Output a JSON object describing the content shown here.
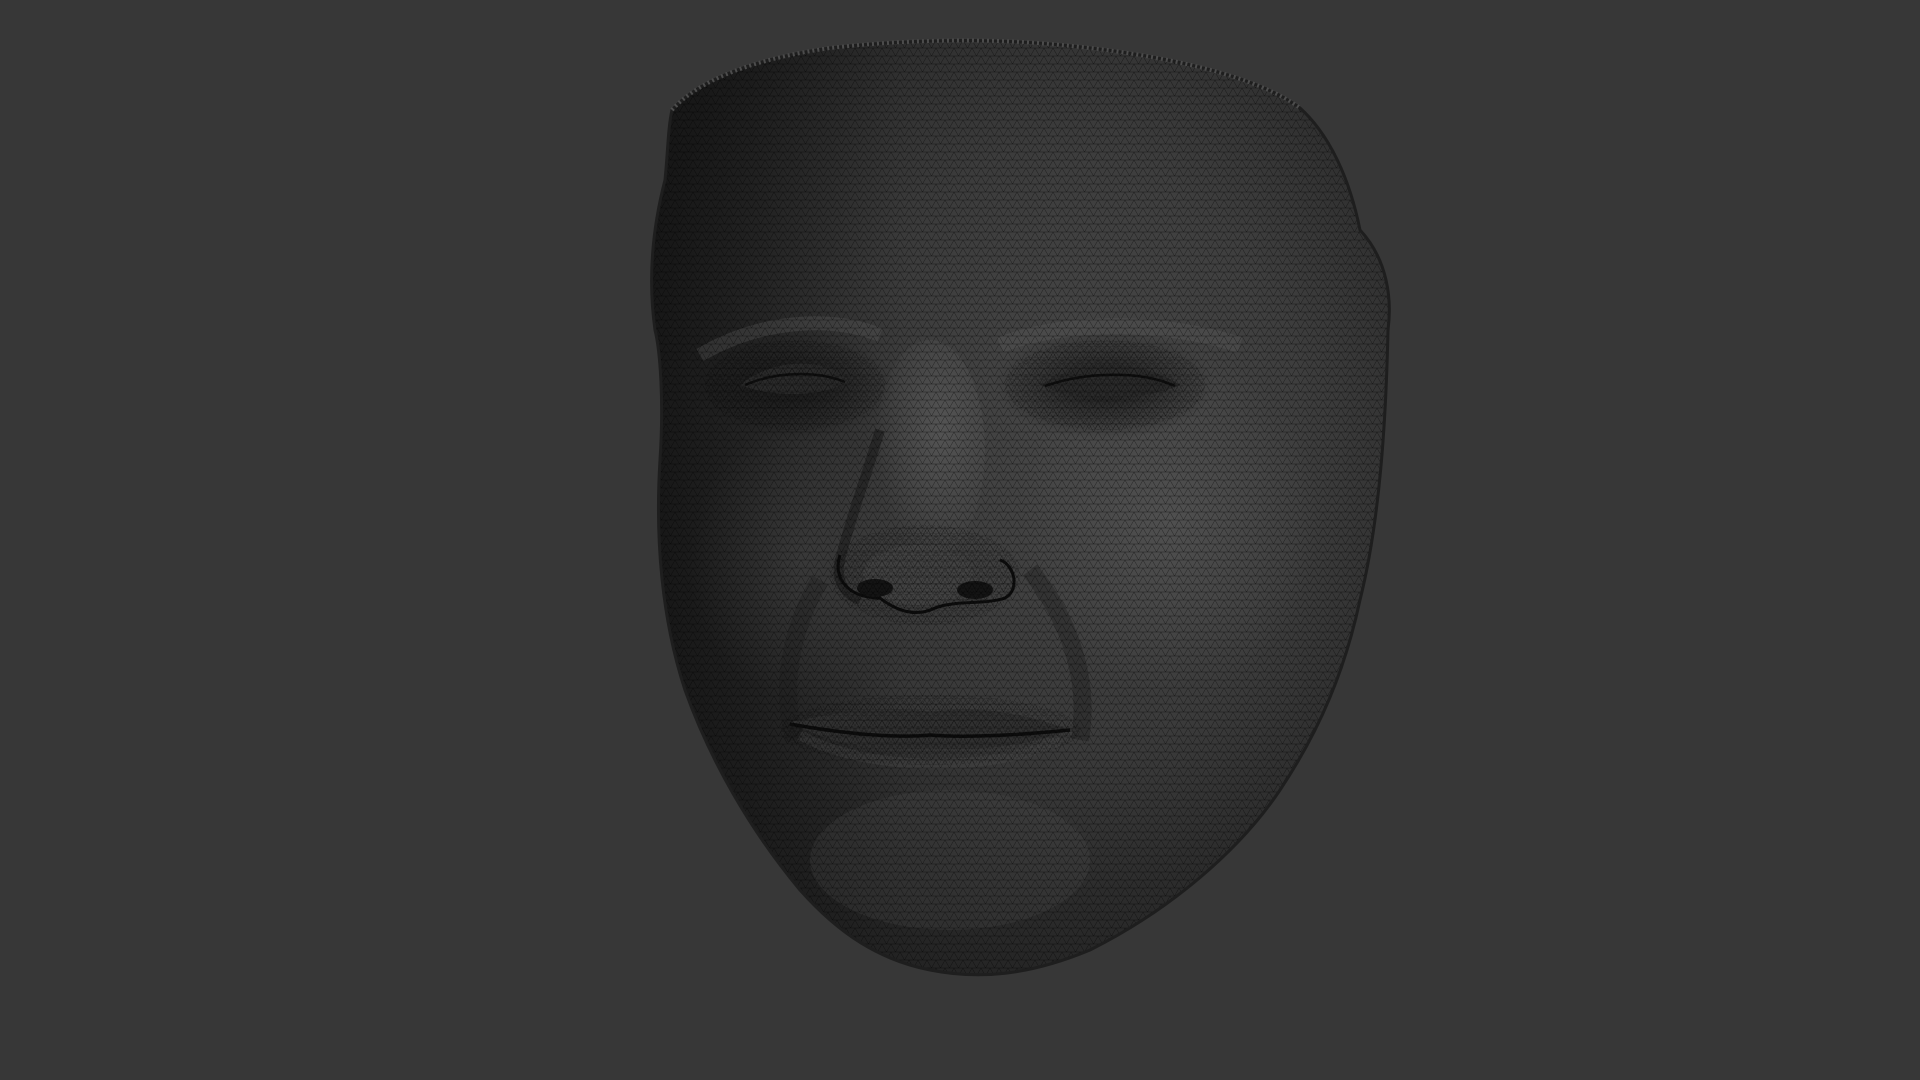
{
  "viewport": {
    "background_color": "#373737",
    "subject": "face-mesh",
    "render_mode": "shaded-wireframe"
  },
  "mesh": {
    "base_color": "#2f2f2f",
    "highlight_color": "#525252",
    "shadow_color": "#1a1a1a",
    "wire_color": "#000000"
  }
}
